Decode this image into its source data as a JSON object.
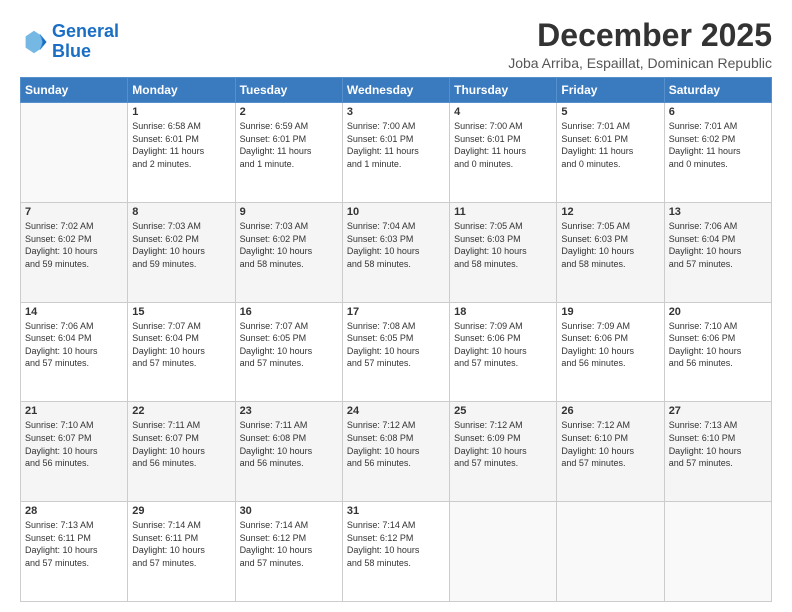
{
  "header": {
    "logo_line1": "General",
    "logo_line2": "Blue",
    "month": "December 2025",
    "location": "Joba Arriba, Espaillat, Dominican Republic"
  },
  "weekdays": [
    "Sunday",
    "Monday",
    "Tuesday",
    "Wednesday",
    "Thursday",
    "Friday",
    "Saturday"
  ],
  "weeks": [
    [
      {
        "day": "",
        "info": ""
      },
      {
        "day": "1",
        "info": "Sunrise: 6:58 AM\nSunset: 6:01 PM\nDaylight: 11 hours\nand 2 minutes."
      },
      {
        "day": "2",
        "info": "Sunrise: 6:59 AM\nSunset: 6:01 PM\nDaylight: 11 hours\nand 1 minute."
      },
      {
        "day": "3",
        "info": "Sunrise: 7:00 AM\nSunset: 6:01 PM\nDaylight: 11 hours\nand 1 minute."
      },
      {
        "day": "4",
        "info": "Sunrise: 7:00 AM\nSunset: 6:01 PM\nDaylight: 11 hours\nand 0 minutes."
      },
      {
        "day": "5",
        "info": "Sunrise: 7:01 AM\nSunset: 6:01 PM\nDaylight: 11 hours\nand 0 minutes."
      },
      {
        "day": "6",
        "info": "Sunrise: 7:01 AM\nSunset: 6:02 PM\nDaylight: 11 hours\nand 0 minutes."
      }
    ],
    [
      {
        "day": "7",
        "info": "Sunrise: 7:02 AM\nSunset: 6:02 PM\nDaylight: 10 hours\nand 59 minutes."
      },
      {
        "day": "8",
        "info": "Sunrise: 7:03 AM\nSunset: 6:02 PM\nDaylight: 10 hours\nand 59 minutes."
      },
      {
        "day": "9",
        "info": "Sunrise: 7:03 AM\nSunset: 6:02 PM\nDaylight: 10 hours\nand 58 minutes."
      },
      {
        "day": "10",
        "info": "Sunrise: 7:04 AM\nSunset: 6:03 PM\nDaylight: 10 hours\nand 58 minutes."
      },
      {
        "day": "11",
        "info": "Sunrise: 7:05 AM\nSunset: 6:03 PM\nDaylight: 10 hours\nand 58 minutes."
      },
      {
        "day": "12",
        "info": "Sunrise: 7:05 AM\nSunset: 6:03 PM\nDaylight: 10 hours\nand 58 minutes."
      },
      {
        "day": "13",
        "info": "Sunrise: 7:06 AM\nSunset: 6:04 PM\nDaylight: 10 hours\nand 57 minutes."
      }
    ],
    [
      {
        "day": "14",
        "info": "Sunrise: 7:06 AM\nSunset: 6:04 PM\nDaylight: 10 hours\nand 57 minutes."
      },
      {
        "day": "15",
        "info": "Sunrise: 7:07 AM\nSunset: 6:04 PM\nDaylight: 10 hours\nand 57 minutes."
      },
      {
        "day": "16",
        "info": "Sunrise: 7:07 AM\nSunset: 6:05 PM\nDaylight: 10 hours\nand 57 minutes."
      },
      {
        "day": "17",
        "info": "Sunrise: 7:08 AM\nSunset: 6:05 PM\nDaylight: 10 hours\nand 57 minutes."
      },
      {
        "day": "18",
        "info": "Sunrise: 7:09 AM\nSunset: 6:06 PM\nDaylight: 10 hours\nand 57 minutes."
      },
      {
        "day": "19",
        "info": "Sunrise: 7:09 AM\nSunset: 6:06 PM\nDaylight: 10 hours\nand 56 minutes."
      },
      {
        "day": "20",
        "info": "Sunrise: 7:10 AM\nSunset: 6:06 PM\nDaylight: 10 hours\nand 56 minutes."
      }
    ],
    [
      {
        "day": "21",
        "info": "Sunrise: 7:10 AM\nSunset: 6:07 PM\nDaylight: 10 hours\nand 56 minutes."
      },
      {
        "day": "22",
        "info": "Sunrise: 7:11 AM\nSunset: 6:07 PM\nDaylight: 10 hours\nand 56 minutes."
      },
      {
        "day": "23",
        "info": "Sunrise: 7:11 AM\nSunset: 6:08 PM\nDaylight: 10 hours\nand 56 minutes."
      },
      {
        "day": "24",
        "info": "Sunrise: 7:12 AM\nSunset: 6:08 PM\nDaylight: 10 hours\nand 56 minutes."
      },
      {
        "day": "25",
        "info": "Sunrise: 7:12 AM\nSunset: 6:09 PM\nDaylight: 10 hours\nand 57 minutes."
      },
      {
        "day": "26",
        "info": "Sunrise: 7:12 AM\nSunset: 6:10 PM\nDaylight: 10 hours\nand 57 minutes."
      },
      {
        "day": "27",
        "info": "Sunrise: 7:13 AM\nSunset: 6:10 PM\nDaylight: 10 hours\nand 57 minutes."
      }
    ],
    [
      {
        "day": "28",
        "info": "Sunrise: 7:13 AM\nSunset: 6:11 PM\nDaylight: 10 hours\nand 57 minutes."
      },
      {
        "day": "29",
        "info": "Sunrise: 7:14 AM\nSunset: 6:11 PM\nDaylight: 10 hours\nand 57 minutes."
      },
      {
        "day": "30",
        "info": "Sunrise: 7:14 AM\nSunset: 6:12 PM\nDaylight: 10 hours\nand 57 minutes."
      },
      {
        "day": "31",
        "info": "Sunrise: 7:14 AM\nSunset: 6:12 PM\nDaylight: 10 hours\nand 58 minutes."
      },
      {
        "day": "",
        "info": ""
      },
      {
        "day": "",
        "info": ""
      },
      {
        "day": "",
        "info": ""
      }
    ]
  ]
}
